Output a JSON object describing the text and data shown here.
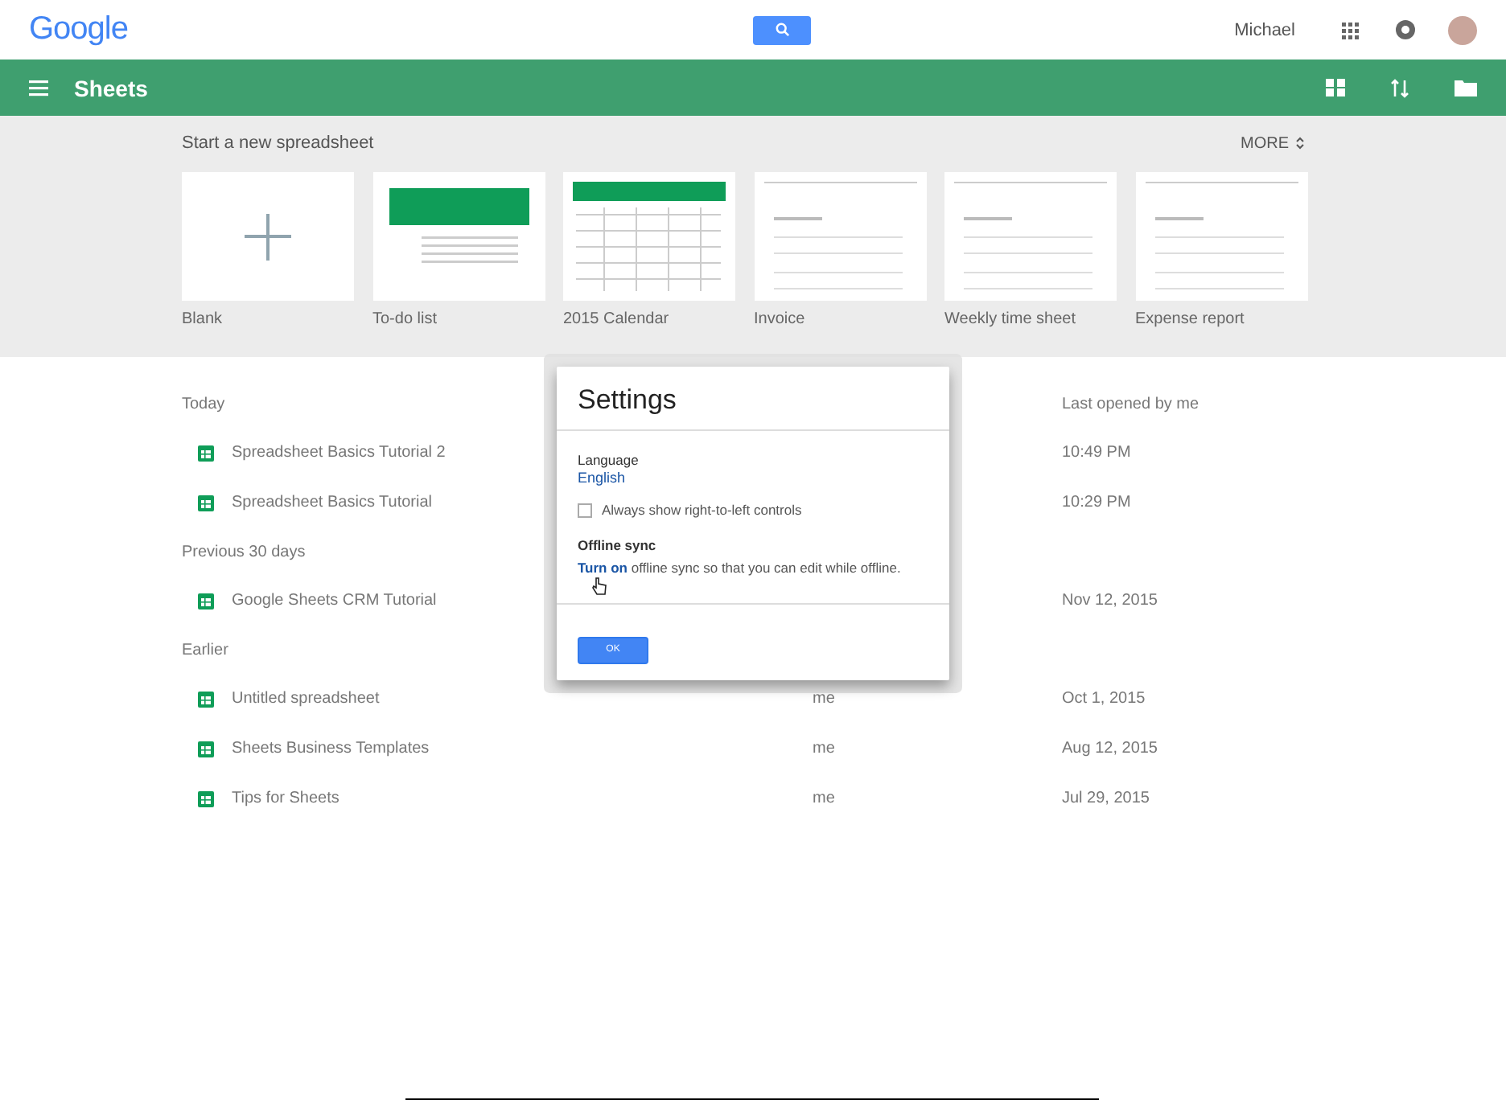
{
  "top_bar": {
    "logo": "Google",
    "account_name": "Michael"
  },
  "app_bar": {
    "title": "Sheets"
  },
  "templates": {
    "heading": "Start a new spreadsheet",
    "more": "MORE",
    "items": [
      {
        "label": "Blank",
        "kind": "blank"
      },
      {
        "label": "To-do list",
        "kind": "todo"
      },
      {
        "label": "2015 Calendar",
        "kind": "calendar"
      },
      {
        "label": "Invoice",
        "kind": "form"
      },
      {
        "label": "Weekly time sheet",
        "kind": "form"
      },
      {
        "label": "Expense report",
        "kind": "form"
      }
    ]
  },
  "files": {
    "column_header": "Last opened by me",
    "sections": [
      {
        "heading": "Today",
        "rows": [
          {
            "name": "Spreadsheet Basics Tutorial 2",
            "last_opened": "10:49 PM"
          },
          {
            "name": "Spreadsheet Basics Tutorial",
            "last_opened": "10:29 PM"
          }
        ]
      },
      {
        "heading": "Previous 30 days",
        "rows": [
          {
            "name": "Google Sheets CRM Tutorial",
            "last_opened": "Nov 12, 2015"
          }
        ]
      },
      {
        "heading": "Earlier",
        "rows": [
          {
            "name": "Untitled spreadsheet",
            "owner": "me",
            "last_opened": "Oct 1, 2015"
          },
          {
            "name": "Sheets Business Templates",
            "owner": "me",
            "last_opened": "Aug 12, 2015"
          },
          {
            "name": "Tips for Sheets",
            "owner": "me",
            "last_opened": "Jul 29, 2015"
          }
        ]
      }
    ]
  },
  "dialog": {
    "title": "Settings",
    "language_label": "Language",
    "language_value": "English",
    "rtl_checkbox": {
      "label": "Always show right-to-left controls",
      "checked": false
    },
    "offline_heading": "Offline sync",
    "offline_link": "Turn on",
    "offline_text": "offline sync so that you can edit while offline.",
    "ok_button": "OK"
  }
}
